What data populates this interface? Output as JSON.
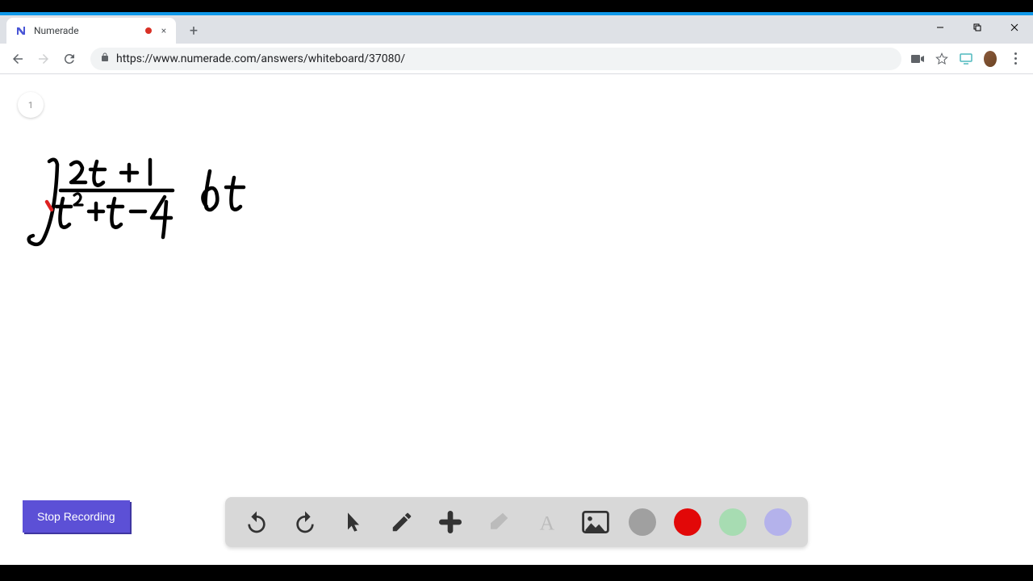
{
  "tab": {
    "title": "Numerade",
    "close_glyph": "×"
  },
  "window": {
    "minimize": "—",
    "maximize": "❐",
    "close": "✕",
    "new_tab": "+"
  },
  "url": "https://www.numerade.com/answers/whiteboard/37080/",
  "page_badge": "1",
  "stop_button": "Stop Recording",
  "math": {
    "description": "Integral of (2t + 1) / (t^2 + t - 4) dt"
  },
  "toolbar": {
    "undo": "undo",
    "redo": "redo",
    "pointer": "pointer",
    "pen": "pen",
    "plus": "plus",
    "eraser": "eraser",
    "text": "text",
    "image": "image"
  },
  "colors": {
    "gray": "#a0a0a0",
    "red": "#e20808",
    "green": "#a7dcb2",
    "purple": "#b4b2eb"
  }
}
